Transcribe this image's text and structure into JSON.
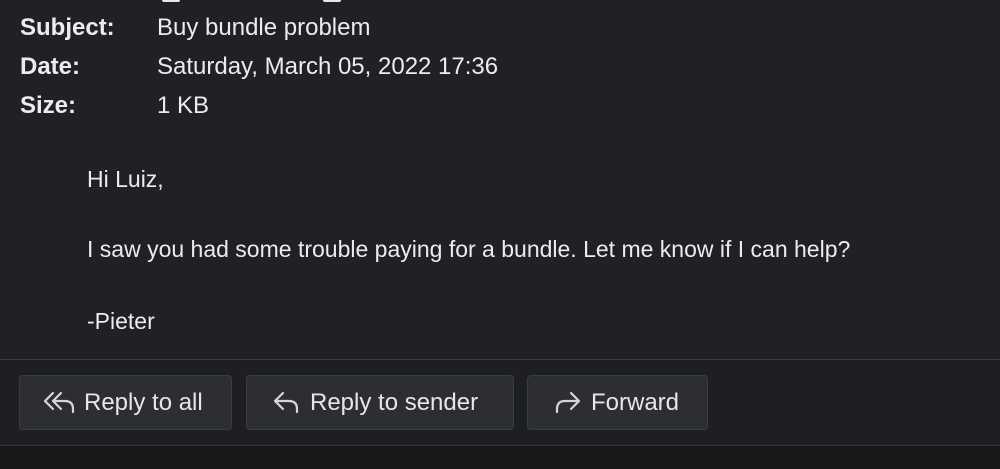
{
  "headers": {
    "subject": {
      "label": "Subject:",
      "value": "Buy bundle problem"
    },
    "date": {
      "label": "Date:",
      "value": "Saturday, March 05, 2022 17:36"
    },
    "size": {
      "label": "Size:",
      "value": "1 KB"
    }
  },
  "message": {
    "greeting": "Hi Luiz,",
    "body": "I saw you had some trouble paying for a bundle. Let me know if I can help?",
    "signature": "-Pieter"
  },
  "actions": {
    "reply_all": {
      "label": "Reply to all",
      "icon": "reply-all-icon"
    },
    "reply_sender": {
      "label": "Reply to sender",
      "icon": "reply-icon"
    },
    "forward": {
      "label": "Forward",
      "icon": "forward-icon"
    }
  },
  "colors": {
    "panel_background": "#202124",
    "button_background": "#2c2e33",
    "text": "#ececec"
  }
}
